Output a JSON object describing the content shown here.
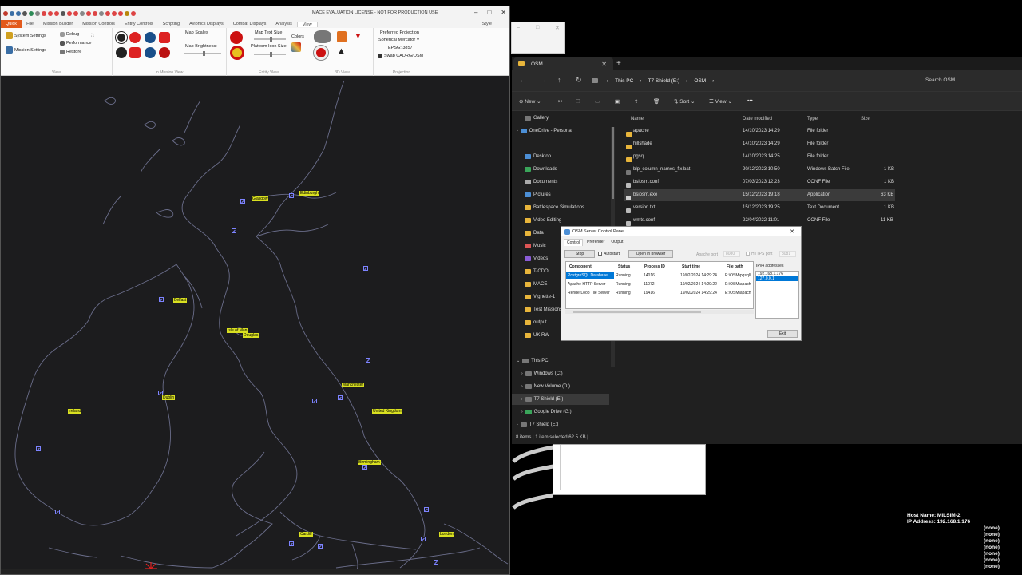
{
  "mace": {
    "title": "MACE EVALUATION LICENSE - NOT FOR PRODUCTION USE",
    "menu": [
      "Quick",
      "File",
      "Mission Builder",
      "Mission Controls",
      "Entity Controls",
      "Scripting",
      "Avionics Displays",
      "Combat Displays",
      "Analysis",
      "View"
    ],
    "style_label": "Style",
    "ribbon": {
      "system_settings": "System Settings",
      "debug": "Debug",
      "performance": "Performance",
      "mission_settings": "Mission Settings",
      "restore": "Restore",
      "view_group": "View",
      "map_scales": "Map Scales",
      "map_brightness": "Map Brightness:",
      "in_mission_view": "In Mission View",
      "map_text_size": "Map Text Size",
      "platform_icon_size": "Platform Icon Size",
      "colors": "Colors",
      "entity_view": "Entity View",
      "view_3d": "3D View",
      "preferred_projection": "Preferred Projection",
      "projection_value": "Spherical Mercator",
      "epsg": "EPSG: 3857",
      "swap_cadrg": "Swap CADRG/OSM",
      "projection_group": "Projection"
    },
    "cities": [
      {
        "name": "Glasgow"
      },
      {
        "name": "Edinburgh"
      },
      {
        "name": "Belfast"
      },
      {
        "name": "Isle of Man"
      },
      {
        "name": "Douglas"
      },
      {
        "name": "Dublin"
      },
      {
        "name": "Ireland"
      },
      {
        "name": "Manchester"
      },
      {
        "name": "United Kingdom"
      },
      {
        "name": "Birmingham"
      },
      {
        "name": "Cardiff"
      },
      {
        "name": "London"
      }
    ]
  },
  "explorer": {
    "tab_title": "OSM",
    "breadcrumb": [
      "This PC",
      "T7 Shield (E:)",
      "OSM"
    ],
    "search_placeholder": "Search OSM",
    "commands": {
      "new": "New",
      "sort": "Sort",
      "view": "View"
    },
    "columns": [
      "Name",
      "Date modified",
      "Type",
      "Size"
    ],
    "files": [
      {
        "name": "apache",
        "date": "14/10/2023 14:29",
        "type": "File folder",
        "size": ""
      },
      {
        "name": "hillshade",
        "date": "14/10/2023 14:29",
        "type": "File folder",
        "size": ""
      },
      {
        "name": "pgsql",
        "date": "14/10/2023 14:25",
        "type": "File folder",
        "size": ""
      },
      {
        "name": "blp_column_names_fix.bat",
        "date": "20/12/2023 10:50",
        "type": "Windows Batch File",
        "size": "1 KB"
      },
      {
        "name": "bsiosm.conf",
        "date": "07/03/2023 12:23",
        "type": "CONF File",
        "size": "1 KB"
      },
      {
        "name": "bsiosm.exe",
        "date": "15/12/2023 19:18",
        "type": "Application",
        "size": "63 KB"
      },
      {
        "name": "version.txt",
        "date": "15/12/2023 19:25",
        "type": "Text Document",
        "size": "1 KB"
      },
      {
        "name": "wmts.conf",
        "date": "22/04/2022 11:01",
        "type": "CONF File",
        "size": "11 KB"
      }
    ],
    "nav": [
      {
        "label": "Gallery",
        "icon": "gallery-icon"
      },
      {
        "label": "OneDrive - Personal",
        "icon": "cloud-icon"
      },
      {
        "label": "Desktop",
        "icon": "desktop-icon"
      },
      {
        "label": "Downloads",
        "icon": "download-icon"
      },
      {
        "label": "Documents",
        "icon": "document-icon"
      },
      {
        "label": "Pictures",
        "icon": "picture-icon"
      },
      {
        "label": "Battlespace Simulations",
        "icon": "folder-icon"
      },
      {
        "label": "Video Editing",
        "icon": "folder-icon"
      },
      {
        "label": "Data",
        "icon": "folder-icon"
      },
      {
        "label": "Music",
        "icon": "music-icon"
      },
      {
        "label": "Videos",
        "icon": "video-icon"
      },
      {
        "label": "T-CDO",
        "icon": "folder-icon"
      },
      {
        "label": "MACE",
        "icon": "folder-icon"
      },
      {
        "label": "Vignette-1",
        "icon": "folder-icon"
      },
      {
        "label": "Test Missions",
        "icon": "folder-icon"
      },
      {
        "label": "output",
        "icon": "folder-icon"
      },
      {
        "label": "UK RW",
        "icon": "folder-icon"
      },
      {
        "label": "This PC",
        "icon": "pc-icon"
      },
      {
        "label": "Windows (C:)",
        "icon": "drive-icon"
      },
      {
        "label": "New Volume (D:)",
        "icon": "drive-icon"
      },
      {
        "label": "T7 Shield (E:)",
        "icon": "drive-icon"
      },
      {
        "label": "Google Drive (G:)",
        "icon": "drive-icon"
      },
      {
        "label": "T7 Shield (E:)",
        "icon": "drive-icon"
      }
    ],
    "status": "8 items  |  1 item selected  62.5 KB  |"
  },
  "panel": {
    "title": "OSM Server Control Panel",
    "tabs": [
      "Control",
      "Prerender",
      "Output"
    ],
    "stop_label": "Stop",
    "autostart_label": "Autostart",
    "open_browser_label": "Open in browser",
    "apache_port_label": "Apache port",
    "apache_port_value": "8080",
    "https_port_label": "HTTPS port",
    "https_port_value": "8081",
    "columns": [
      "Component",
      "Status",
      "Process ID",
      "Start time",
      "File path"
    ],
    "rows": [
      {
        "component": "PostgreSQL Database",
        "status": "Running",
        "pid": "14016",
        "start": "19/02/2024 14:29:24",
        "path": "E:\\OSM\\pgsql\\"
      },
      {
        "component": "Apache HTTP Server",
        "status": "Running",
        "pid": "11072",
        "start": "19/02/2024 14:29:22",
        "path": "E:\\OSM\\apach"
      },
      {
        "component": "RenderLoop Tile Server",
        "status": "Running",
        "pid": "19416",
        "start": "19/02/2024 14:29:24",
        "path": "E:\\OSM\\apach"
      }
    ],
    "ipv4_label": "IPv4 addresses",
    "ips": [
      "192.168.1.176",
      "127.0.0.1"
    ],
    "exit_label": "Exit"
  },
  "host": {
    "name_label": "Host Name: MILSIM-2",
    "ip_label": "IP Address: 192.168.1.176",
    "none_lines": [
      "(none)",
      "(none)",
      "(none)",
      "(none)",
      "(none)",
      "(none)",
      "(none)"
    ]
  }
}
